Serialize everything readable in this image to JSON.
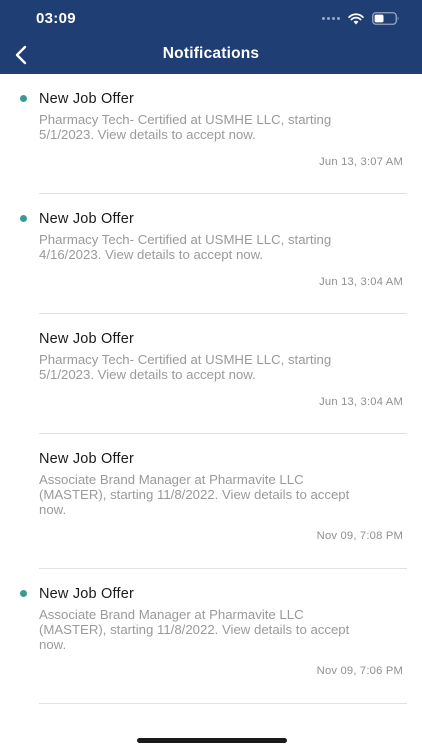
{
  "status_bar": {
    "time": "03:09",
    "signal_icon": "signal-dots-icon",
    "wifi_icon": "wifi-icon",
    "battery_icon": "battery-icon",
    "battery_level": 0.45
  },
  "header": {
    "title": "Notifications",
    "back_icon": "chevron-left-icon",
    "background_color": "#1f3e73"
  },
  "notifications": [
    {
      "title": "New Job Offer",
      "body": "Pharmacy Tech- Certified at USMHE LLC, starting\n5/1/2023.  View details to accept now.",
      "time": "Jun 13, 3:07 AM",
      "unread": true
    },
    {
      "title": "New Job Offer",
      "body": "Pharmacy Tech- Certified at USMHE LLC, starting\n4/16/2023.  View details to accept now.",
      "time": "Jun 13, 3:04 AM",
      "unread": true
    },
    {
      "title": "New Job Offer",
      "body": "Pharmacy Tech- Certified at USMHE LLC, starting\n5/1/2023.  View details to accept now.",
      "time": "Jun 13, 3:04 AM",
      "unread": false
    },
    {
      "title": "New Job Offer",
      "body": "Associate Brand Manager at Pharmavite LLC\n(MASTER), starting 11/8/2022.  View details to accept\nnow.",
      "time": "Nov 09, 7:08 PM",
      "unread": false
    },
    {
      "title": "New Job Offer",
      "body": "Associate Brand Manager at Pharmavite LLC\n(MASTER), starting 11/8/2022.  View details to accept\nnow.",
      "time": "Nov 09, 7:06 PM",
      "unread": true
    }
  ],
  "colors": {
    "unread_dot": "#3a9b95",
    "body_text": "#9a9a9a"
  }
}
